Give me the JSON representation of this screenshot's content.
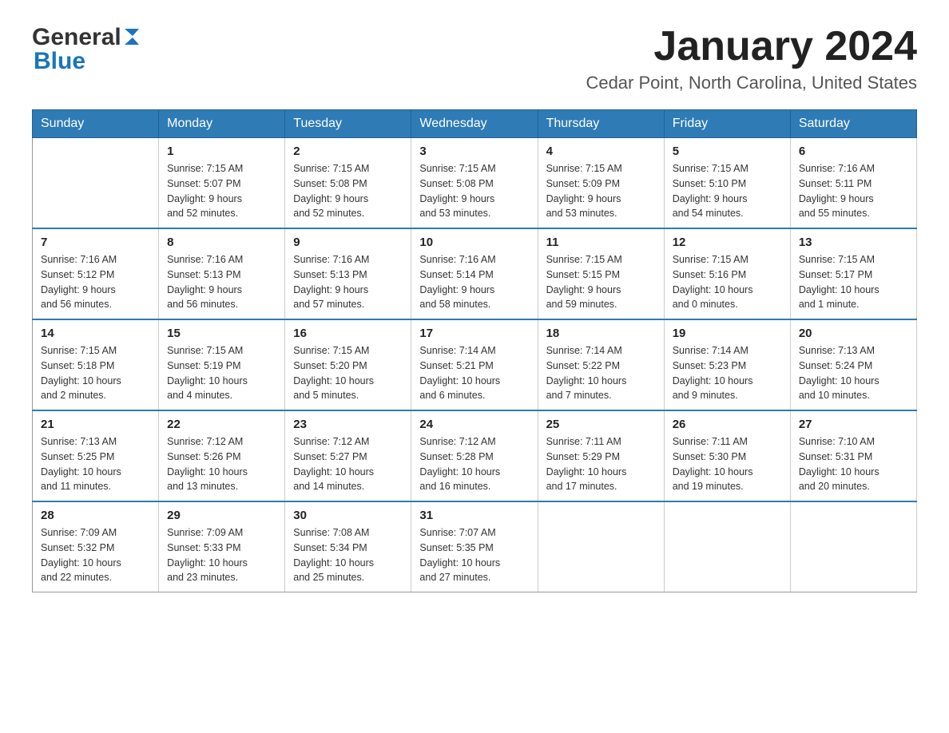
{
  "header": {
    "logo": {
      "general": "General",
      "blue": "Blue"
    },
    "title": "January 2024",
    "location": "Cedar Point, North Carolina, United States"
  },
  "calendar": {
    "days_of_week": [
      "Sunday",
      "Monday",
      "Tuesday",
      "Wednesday",
      "Thursday",
      "Friday",
      "Saturday"
    ],
    "weeks": [
      [
        {
          "day": "",
          "info": ""
        },
        {
          "day": "1",
          "info": "Sunrise: 7:15 AM\nSunset: 5:07 PM\nDaylight: 9 hours\nand 52 minutes."
        },
        {
          "day": "2",
          "info": "Sunrise: 7:15 AM\nSunset: 5:08 PM\nDaylight: 9 hours\nand 52 minutes."
        },
        {
          "day": "3",
          "info": "Sunrise: 7:15 AM\nSunset: 5:08 PM\nDaylight: 9 hours\nand 53 minutes."
        },
        {
          "day": "4",
          "info": "Sunrise: 7:15 AM\nSunset: 5:09 PM\nDaylight: 9 hours\nand 53 minutes."
        },
        {
          "day": "5",
          "info": "Sunrise: 7:15 AM\nSunset: 5:10 PM\nDaylight: 9 hours\nand 54 minutes."
        },
        {
          "day": "6",
          "info": "Sunrise: 7:16 AM\nSunset: 5:11 PM\nDaylight: 9 hours\nand 55 minutes."
        }
      ],
      [
        {
          "day": "7",
          "info": "Sunrise: 7:16 AM\nSunset: 5:12 PM\nDaylight: 9 hours\nand 56 minutes."
        },
        {
          "day": "8",
          "info": "Sunrise: 7:16 AM\nSunset: 5:13 PM\nDaylight: 9 hours\nand 56 minutes."
        },
        {
          "day": "9",
          "info": "Sunrise: 7:16 AM\nSunset: 5:13 PM\nDaylight: 9 hours\nand 57 minutes."
        },
        {
          "day": "10",
          "info": "Sunrise: 7:16 AM\nSunset: 5:14 PM\nDaylight: 9 hours\nand 58 minutes."
        },
        {
          "day": "11",
          "info": "Sunrise: 7:15 AM\nSunset: 5:15 PM\nDaylight: 9 hours\nand 59 minutes."
        },
        {
          "day": "12",
          "info": "Sunrise: 7:15 AM\nSunset: 5:16 PM\nDaylight: 10 hours\nand 0 minutes."
        },
        {
          "day": "13",
          "info": "Sunrise: 7:15 AM\nSunset: 5:17 PM\nDaylight: 10 hours\nand 1 minute."
        }
      ],
      [
        {
          "day": "14",
          "info": "Sunrise: 7:15 AM\nSunset: 5:18 PM\nDaylight: 10 hours\nand 2 minutes."
        },
        {
          "day": "15",
          "info": "Sunrise: 7:15 AM\nSunset: 5:19 PM\nDaylight: 10 hours\nand 4 minutes."
        },
        {
          "day": "16",
          "info": "Sunrise: 7:15 AM\nSunset: 5:20 PM\nDaylight: 10 hours\nand 5 minutes."
        },
        {
          "day": "17",
          "info": "Sunrise: 7:14 AM\nSunset: 5:21 PM\nDaylight: 10 hours\nand 6 minutes."
        },
        {
          "day": "18",
          "info": "Sunrise: 7:14 AM\nSunset: 5:22 PM\nDaylight: 10 hours\nand 7 minutes."
        },
        {
          "day": "19",
          "info": "Sunrise: 7:14 AM\nSunset: 5:23 PM\nDaylight: 10 hours\nand 9 minutes."
        },
        {
          "day": "20",
          "info": "Sunrise: 7:13 AM\nSunset: 5:24 PM\nDaylight: 10 hours\nand 10 minutes."
        }
      ],
      [
        {
          "day": "21",
          "info": "Sunrise: 7:13 AM\nSunset: 5:25 PM\nDaylight: 10 hours\nand 11 minutes."
        },
        {
          "day": "22",
          "info": "Sunrise: 7:12 AM\nSunset: 5:26 PM\nDaylight: 10 hours\nand 13 minutes."
        },
        {
          "day": "23",
          "info": "Sunrise: 7:12 AM\nSunset: 5:27 PM\nDaylight: 10 hours\nand 14 minutes."
        },
        {
          "day": "24",
          "info": "Sunrise: 7:12 AM\nSunset: 5:28 PM\nDaylight: 10 hours\nand 16 minutes."
        },
        {
          "day": "25",
          "info": "Sunrise: 7:11 AM\nSunset: 5:29 PM\nDaylight: 10 hours\nand 17 minutes."
        },
        {
          "day": "26",
          "info": "Sunrise: 7:11 AM\nSunset: 5:30 PM\nDaylight: 10 hours\nand 19 minutes."
        },
        {
          "day": "27",
          "info": "Sunrise: 7:10 AM\nSunset: 5:31 PM\nDaylight: 10 hours\nand 20 minutes."
        }
      ],
      [
        {
          "day": "28",
          "info": "Sunrise: 7:09 AM\nSunset: 5:32 PM\nDaylight: 10 hours\nand 22 minutes."
        },
        {
          "day": "29",
          "info": "Sunrise: 7:09 AM\nSunset: 5:33 PM\nDaylight: 10 hours\nand 23 minutes."
        },
        {
          "day": "30",
          "info": "Sunrise: 7:08 AM\nSunset: 5:34 PM\nDaylight: 10 hours\nand 25 minutes."
        },
        {
          "day": "31",
          "info": "Sunrise: 7:07 AM\nSunset: 5:35 PM\nDaylight: 10 hours\nand 27 minutes."
        },
        {
          "day": "",
          "info": ""
        },
        {
          "day": "",
          "info": ""
        },
        {
          "day": "",
          "info": ""
        }
      ]
    ]
  }
}
